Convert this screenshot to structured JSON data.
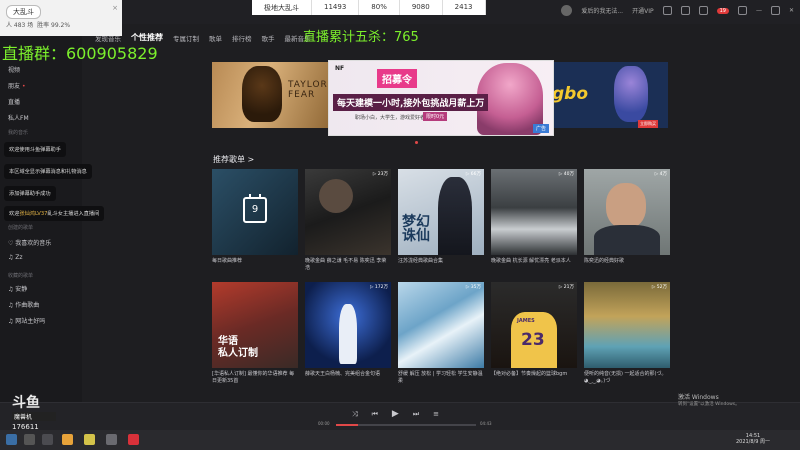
{
  "stream": {
    "room_name": "大乱斗",
    "count_line": "人 483 场",
    "win_rate": "胜率 99.2%",
    "close": "×",
    "qq_overlay": "直播群：600905829",
    "kills_overlay": "直播累计五杀：765",
    "stats": [
      "极地大乱斗",
      "11493",
      "80%",
      "9080",
      "2413"
    ],
    "platform": "斗鱼",
    "platform_badge": "魔兽机",
    "room_id": "176611"
  },
  "nav": {
    "tabs": [
      "发现音乐",
      "个性推荐",
      "专属订制",
      "歌单",
      "排行榜",
      "歌手",
      "最新音乐"
    ],
    "search_icon": "search-icon"
  },
  "titlebar": {
    "user": "爱后的我无法...",
    "vip": "开通VIP",
    "badge": "19"
  },
  "sidebar": {
    "items": [
      {
        "label": "视频"
      },
      {
        "label": "朋友"
      },
      {
        "label": "直播"
      },
      {
        "label": "私人FM"
      }
    ],
    "head_mine": "我的音乐",
    "playlist_head": "创建的歌单",
    "playlists": [
      {
        "label": "我喜欢的音乐"
      },
      {
        "label": "Zz"
      }
    ],
    "collected_head": "收藏的歌单",
    "collected": [
      {
        "label": "安静"
      },
      {
        "label": "作曲歌曲"
      },
      {
        "label": "网站主好吗"
      }
    ]
  },
  "chat": [
    {
      "text": "欢迎使用斗鱼弹幕助手"
    },
    {
      "text": "本区域全显示弹幕消息和礼物消息"
    },
    {
      "text": "添加弹幕助手成功"
    },
    {
      "prefix": "欢迎",
      "highlight": "张灿鸿LV37",
      "suffix": "乱斗女主播进入直播间"
    }
  ],
  "banner": {
    "left_text": "TAYLOR FEAR",
    "center_logo": "NF",
    "center_recruit": "招募令",
    "center_headline": "每天建模一小时,接外包挑战月薪上万",
    "center_sub": "职场小白，大学生，游戏爱好者",
    "center_tag": "限时0元",
    "center_ad": "广告",
    "right_text": "gbo",
    "right_btn": "立即购买"
  },
  "section": {
    "title": "推荐歌单",
    "arrow": ">"
  },
  "cards_row1": [
    {
      "cover": "calendar",
      "day": "9",
      "count": "",
      "caption": "每日歌曲推荐"
    },
    {
      "cover": "photo-dark",
      "count": "▷ 23万",
      "caption": "晚歌金曲 薛之谦 毛不易 陈奕迅 李荣浩"
    },
    {
      "cover": "photo-boy",
      "count": "▷ 66万",
      "caption": "汪苏泷经典歌曲合集"
    },
    {
      "cover": "photo-sea",
      "count": "▷ 40万",
      "caption": "晚歌金曲 杭长源 解忧漂亮 老派本人"
    },
    {
      "cover": "photo-man",
      "count": "▷ 4万",
      "caption": "陈奕迅的经典好歌"
    }
  ],
  "cards_row2": [
    {
      "cover": "huayu",
      "line1": "华语",
      "line2": "私人订制",
      "count": "",
      "caption": "[华语私人订制] 最懂你的华语推荐 每日更新35首"
    },
    {
      "cover": "stage",
      "count": "▷ 172万",
      "caption": "薛歌天王白杨楠、完美组合金句语"
    },
    {
      "cover": "snow",
      "count": "▷ 35万",
      "caption": "舒缓 解压 放松 | 学习轻松 学生安静温柔"
    },
    {
      "cover": "james",
      "count": "▷ 21万",
      "caption": "【绝对必备】节奏燥起的篮球bgm"
    },
    {
      "cover": "forest",
      "count": "▷ 52万",
      "caption": "便听的纯音(无损) 一起适合的那(づ｡◕‿‿◕｡)づ"
    }
  ],
  "player": {
    "time_left": "00:00",
    "time_right": "04:43",
    "progress": 0.16
  },
  "windows": {
    "activate": "激活 Windows",
    "activate_sub": "转到\"设置\"以激活 Windows。",
    "time": "14:51",
    "date": "2021/8/9 周一"
  }
}
